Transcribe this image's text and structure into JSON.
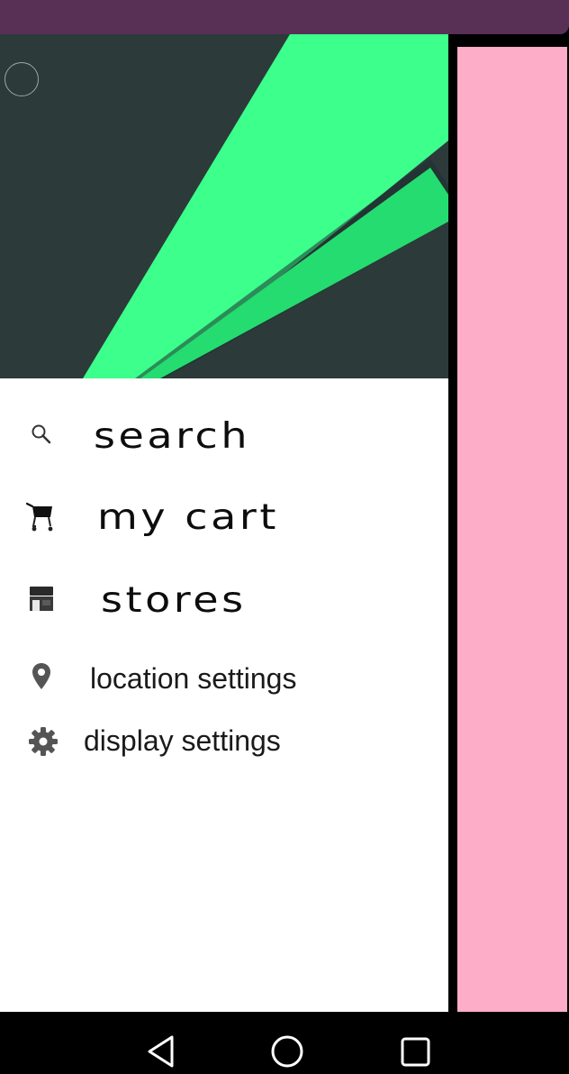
{
  "menu": {
    "items": [
      {
        "label": "search",
        "icon": "search-icon"
      },
      {
        "label": "my cart",
        "icon": "cart-icon"
      },
      {
        "label": "stores",
        "icon": "store-icon"
      },
      {
        "label": "location settings",
        "icon": "location-pin-icon"
      },
      {
        "label": "display settings",
        "icon": "gear-icon"
      }
    ]
  },
  "colors": {
    "status_bar": "#582f55",
    "header_background": "#2c3a3a",
    "header_accent": "#3cff8c",
    "header_accent_dark": "#22d96e",
    "overlay_panel": "#fdadc8",
    "drawer_background": "#ffffff",
    "nav_bar": "#000000"
  },
  "navigation": {
    "back": "back-icon",
    "home": "home-icon",
    "recents": "recents-icon"
  }
}
